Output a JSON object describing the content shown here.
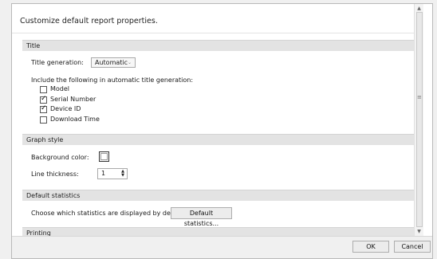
{
  "header": {
    "text": "Customize default report properties."
  },
  "sections": {
    "title": {
      "heading": "Title",
      "generation_label": "Title generation:",
      "generation_value": "Automatic",
      "include_label": "Include the following in automatic title generation:",
      "options": [
        {
          "label": "Model",
          "checked": false
        },
        {
          "label": "Serial Number",
          "checked": true
        },
        {
          "label": "Device ID",
          "checked": true
        },
        {
          "label": "Download Time",
          "checked": false
        }
      ]
    },
    "graph_style": {
      "heading": "Graph style",
      "background_label": "Background color:",
      "line_thickness_label": "Line thickness:",
      "line_thickness_value": "1"
    },
    "default_statistics": {
      "heading": "Default statistics",
      "choose_label": "Choose which statistics are displayed by default:",
      "button_label": "Default statistics..."
    },
    "printing": {
      "heading": "Printing"
    }
  },
  "footer": {
    "ok_label": "OK",
    "cancel_label": "Cancel"
  },
  "colors": {
    "section_bar": "#e3e3e3",
    "dialog_bg": "#ffffff",
    "window_bg": "#f0f0f0"
  }
}
